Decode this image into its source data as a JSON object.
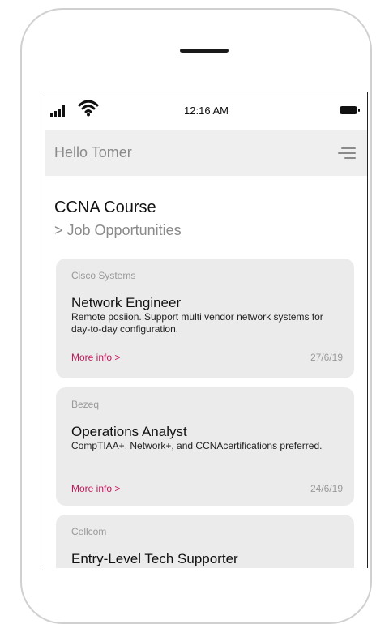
{
  "status_bar": {
    "time": "12:16 AM"
  },
  "header": {
    "greeting": "Hello Tomer"
  },
  "page": {
    "title": "CCNA Course",
    "subtitle": "> Job Opportunities"
  },
  "jobs": [
    {
      "company": "Cisco Systems",
      "title": "Network Engineer",
      "description": "Remote posiion. Support multi vendor network systems for day-to-day configuration.",
      "link": "More info >",
      "date": "27/6/19"
    },
    {
      "company": "Bezeq",
      "title": "Operations Analyst",
      "description": "CompTIAA+, Network+, and CCNAcertifications preferred.",
      "link": "More info >",
      "date": "24/6/19"
    },
    {
      "company": "Cellcom",
      "title": "Entry-Level Tech Supporter",
      "description": "",
      "link": "",
      "date": ""
    }
  ],
  "colors": {
    "accent": "#c2185b",
    "card_bg": "#ebebeb",
    "appbar_bg": "#efefef"
  },
  "icons": [
    "signal-icon",
    "wifi-icon",
    "battery-icon",
    "hamburger-menu-icon"
  ]
}
